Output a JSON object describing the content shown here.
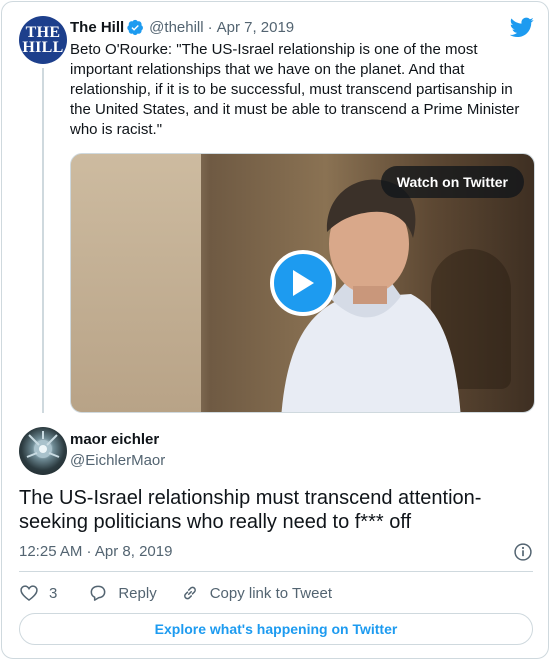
{
  "parent_tweet": {
    "avatar_text_line1": "THE",
    "avatar_text_line2": "HILL",
    "name": "The Hill",
    "handle": "@thehill",
    "separator": "·",
    "date": "Apr 7, 2019",
    "verified_icon": "verified-badge-icon",
    "text": "Beto O'Rourke: \"The US-Israel relationship is one of the most important relationships that we have on the planet. And that relationship, if it is to be successful, must transcend partisanship in the United States, and it must be able to transcend a Prime Minister who is racist.\"",
    "media": {
      "watch_label": "Watch on Twitter",
      "play_icon": "play-icon"
    }
  },
  "tweet": {
    "name": "maor eichler",
    "handle": "@EichlerMaor",
    "text": "The US-Israel relationship must transcend attention-seeking politicians who really need to f*** off",
    "timestamp": "12:25 AM · Apr 8, 2019"
  },
  "actions": {
    "like_count": "3",
    "reply_label": "Reply",
    "copy_link_label": "Copy link to Tweet"
  },
  "explore_label": "Explore what's happening on Twitter",
  "colors": {
    "brand_blue": "#1d9bf0",
    "hill_blue": "#1d3f8c",
    "muted": "#536471",
    "border": "#cfd9de"
  }
}
